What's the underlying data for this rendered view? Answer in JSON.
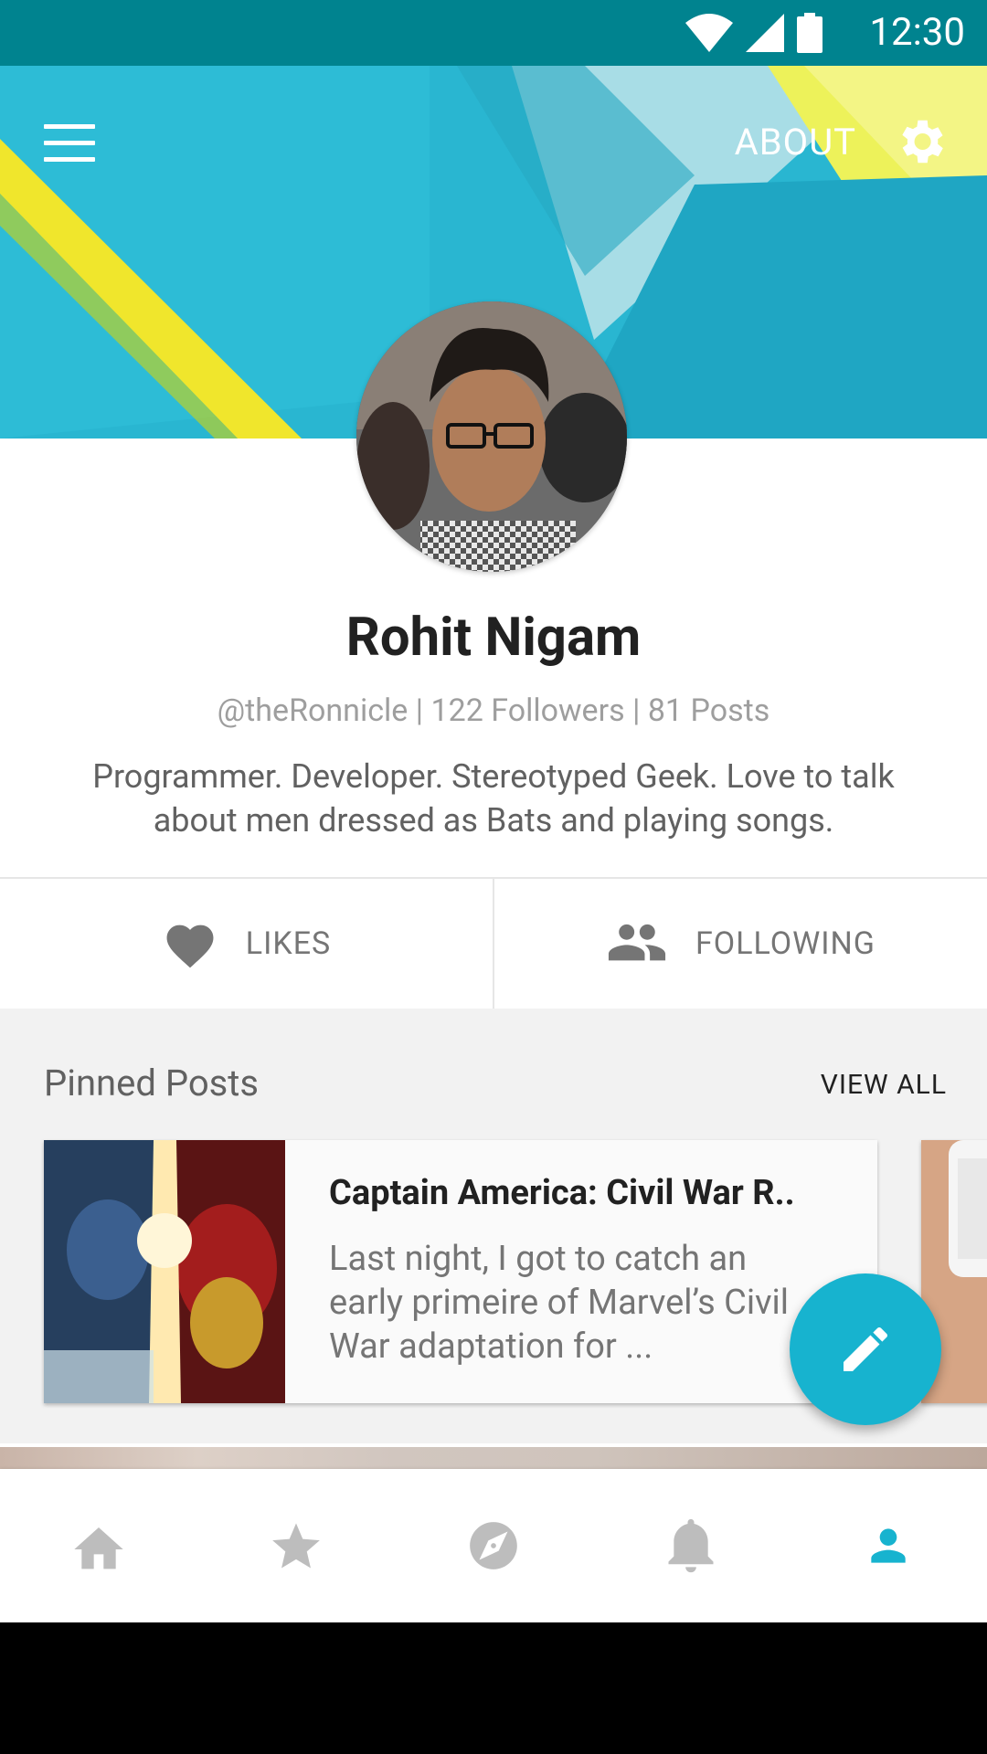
{
  "status_bar": {
    "time": "12:30"
  },
  "header": {
    "about_label": "ABOUT"
  },
  "profile": {
    "name": "Rohit Nigam",
    "meta": "@theRonnicle | 122 Followers | 81 Posts",
    "bio": "Programmer. Developer. Stereotyped Geek. Love to talk about men dressed as Bats and playing songs."
  },
  "tabs": [
    {
      "label": "LIKES",
      "icon": "heart-icon"
    },
    {
      "label": "FOLLOWING",
      "icon": "people-icon"
    }
  ],
  "pinned": {
    "title": "Pinned Posts",
    "view_all": "VIEW ALL",
    "posts": [
      {
        "title": "Captain America: Civil War R..",
        "excerpt": "Last night, I got to catch an early primeire of Marvel’s Civil War adaptation for ..."
      }
    ]
  },
  "bottom_nav": {
    "items": [
      "home-icon",
      "star-icon",
      "explore-icon",
      "bell-icon",
      "person-icon"
    ],
    "active_index": 4
  },
  "colors": {
    "status_bar": "#00838F",
    "accent": "#17B3CF",
    "header_bg": "#29B6D1",
    "yellow": "#F5E630"
  }
}
